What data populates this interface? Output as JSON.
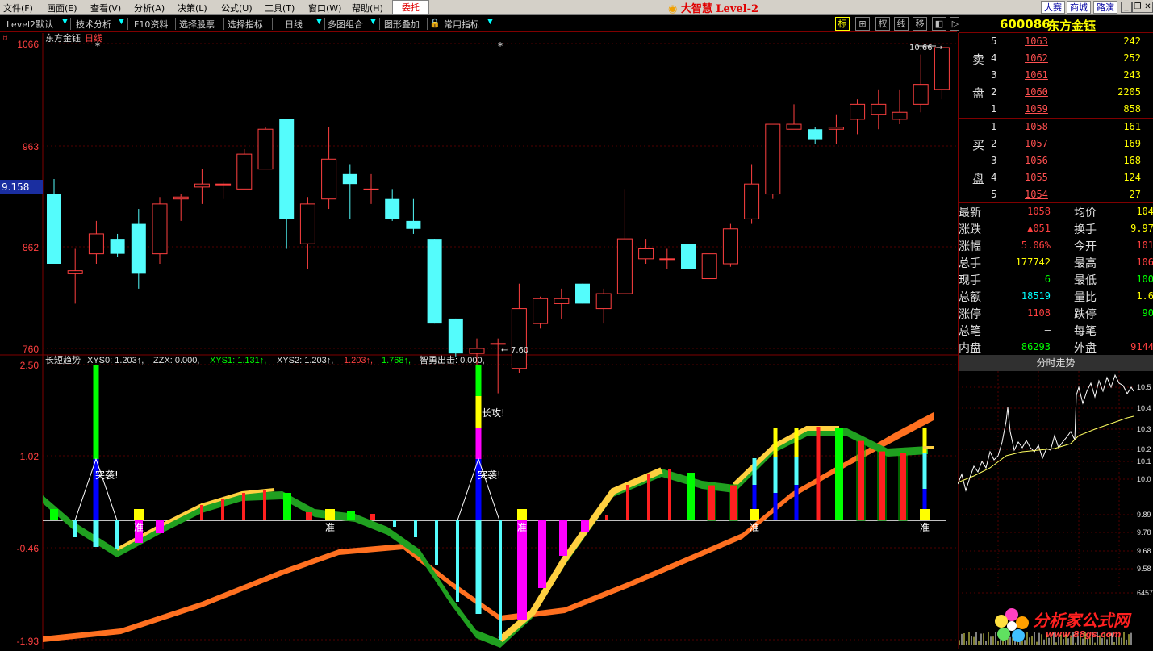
{
  "menubar": {
    "items": [
      "文件(F)",
      "画面(E)",
      "查看(V)",
      "分析(A)",
      "决策(L)",
      "公式(U)",
      "工具(T)",
      "窗口(W)",
      "帮助(H)"
    ],
    "weituo": "委托",
    "app_title": "大智慧 Level-2",
    "links": [
      "大赛",
      "商城",
      "路演"
    ]
  },
  "toolbar": {
    "items": [
      "Level2默认",
      "技术分析",
      "F10资料",
      "选择股票",
      "选择指标",
      "日线",
      "多图组合",
      "图形叠加",
      "常用指标"
    ],
    "icons": [
      "标",
      "⊞",
      "权",
      "线",
      "移",
      "◧",
      "▷"
    ]
  },
  "stock": {
    "code": "600086",
    "name": "东方金钰"
  },
  "chart": {
    "title": "东方金钰",
    "period": "日线",
    "price_axis": [
      "1066",
      "963",
      "862",
      "760"
    ],
    "crosshair_value": "9.158",
    "high_label": "10.66",
    "low_label": "7.60",
    "indicator_legend": [
      {
        "text": "长短趋势",
        "color": "#e0e0e0"
      },
      {
        "text": "XYS0: 1.203↑,",
        "color": "#e0e0e0"
      },
      {
        "text": "ZZX: 0.000,",
        "color": "#e0e0e0"
      },
      {
        "text": "XYS1: 1.131↑,",
        "color": "#00ff00"
      },
      {
        "text": "XYS2: 1.203↑,",
        "color": "#e0e0e0"
      },
      {
        "text": "1.203↑,",
        "color": "#ff4040"
      },
      {
        "text": "1.768↑,",
        "color": "#00ff00"
      },
      {
        "text": "智勇出击: 0.000,",
        "color": "#e0e0e0"
      }
    ],
    "indicator_axis": [
      "2.50",
      "1.02",
      "-0.46",
      "-1.93"
    ],
    "annotations": {
      "tuxi": "突袭!",
      "changgong": "长攻!",
      "zhun": "准"
    }
  },
  "chart_data": {
    "type": "candlestick",
    "ylim": [
      7.6,
      10.66
    ],
    "candles": [
      [
        9.15,
        8.45,
        9.3,
        8.45
      ],
      [
        8.35,
        8.38,
        8.6,
        8.05
      ],
      [
        8.55,
        8.75,
        8.88,
        8.45
      ],
      [
        8.7,
        8.55,
        8.75,
        8.52
      ],
      [
        8.85,
        8.35,
        9.0,
        8.2
      ],
      [
        8.55,
        9.05,
        9.12,
        8.45
      ],
      [
        9.1,
        9.12,
        9.15,
        8.88
      ],
      [
        9.22,
        9.25,
        9.4,
        9.05
      ],
      [
        9.25,
        9.25,
        9.28,
        9.1
      ],
      [
        9.2,
        9.55,
        9.6,
        9.2
      ],
      [
        9.4,
        9.8,
        9.82,
        9.4
      ],
      [
        9.9,
        8.9,
        9.9,
        8.6
      ],
      [
        8.65,
        9.05,
        9.12,
        8.4
      ],
      [
        9.1,
        9.5,
        9.82,
        9.0
      ],
      [
        9.35,
        9.25,
        9.45,
        8.9
      ],
      [
        9.2,
        9.2,
        9.35,
        9.05
      ],
      [
        9.1,
        8.9,
        9.2,
        8.88
      ],
      [
        8.88,
        8.8,
        9.1,
        8.75
      ],
      [
        8.7,
        7.85,
        8.7,
        7.85
      ],
      [
        7.9,
        7.55,
        7.9,
        7.52
      ],
      [
        7.55,
        7.6,
        7.7,
        7.4
      ],
      [
        7.65,
        7.65,
        7.7,
        7.15
      ],
      [
        7.4,
        8.0,
        8.25,
        7.35
      ],
      [
        7.85,
        8.1,
        8.12,
        7.8
      ],
      [
        8.05,
        8.1,
        8.2,
        7.9
      ],
      [
        8.25,
        8.05,
        8.25,
        8.05
      ],
      [
        8.0,
        8.15,
        8.2,
        7.85
      ],
      [
        8.15,
        8.7,
        9.2,
        8.15
      ],
      [
        8.5,
        8.6,
        8.7,
        8.45
      ],
      [
        8.5,
        8.5,
        8.6,
        8.4
      ],
      [
        8.65,
        8.4,
        8.65,
        8.4
      ],
      [
        8.3,
        8.55,
        8.55,
        8.3
      ],
      [
        8.45,
        8.8,
        8.85,
        8.42
      ],
      [
        8.9,
        9.25,
        9.45,
        8.85
      ],
      [
        9.15,
        9.85,
        9.85,
        9.1
      ],
      [
        9.8,
        9.85,
        10.05,
        9.8
      ],
      [
        9.8,
        9.7,
        9.82,
        9.65
      ],
      [
        9.8,
        9.82,
        9.95,
        9.65
      ],
      [
        9.9,
        10.05,
        10.1,
        9.75
      ],
      [
        9.95,
        10.05,
        10.2,
        9.8
      ],
      [
        9.9,
        9.97,
        10.2,
        9.85
      ],
      [
        10.05,
        10.25,
        10.55,
        9.97
      ],
      [
        10.2,
        10.62,
        10.66,
        10.1
      ]
    ]
  },
  "orderbook": {
    "sell_label": [
      "卖",
      "盘"
    ],
    "buy_label": [
      "买",
      "盘"
    ],
    "sell": [
      {
        "level": "5",
        "price": "1063",
        "vol": "242"
      },
      {
        "level": "4",
        "price": "1062",
        "vol": "252"
      },
      {
        "level": "3",
        "price": "1061",
        "vol": "243"
      },
      {
        "level": "2",
        "price": "1060",
        "vol": "2205"
      },
      {
        "level": "1",
        "price": "1059",
        "vol": "858"
      }
    ],
    "buy": [
      {
        "level": "1",
        "price": "1058",
        "vol": "161"
      },
      {
        "level": "2",
        "price": "1057",
        "vol": "169"
      },
      {
        "level": "3",
        "price": "1056",
        "vol": "168"
      },
      {
        "level": "4",
        "price": "1055",
        "vol": "124"
      },
      {
        "level": "5",
        "price": "1054",
        "vol": "27"
      }
    ]
  },
  "stats": [
    {
      "l": "最新",
      "v": "1058",
      "c": "#ff4040",
      "l2": "均价",
      "v2": "104",
      "c2": "#ffff00"
    },
    {
      "l": "涨跌",
      "v": "▲051",
      "c": "#ff4040",
      "l2": "换手",
      "v2": "9.97",
      "c2": "#ffff00"
    },
    {
      "l": "涨幅",
      "v": "5.06%",
      "c": "#ff4040",
      "l2": "今开",
      "v2": "101",
      "c2": "#ff4040"
    },
    {
      "l": "总手",
      "v": "177742",
      "c": "#ffff00",
      "l2": "最高",
      "v2": "106",
      "c2": "#ff4040"
    },
    {
      "l": "现手",
      "v": "6",
      "c": "#00ff00",
      "l2": "最低",
      "v2": "100",
      "c2": "#00ff00"
    },
    {
      "l": "总额",
      "v": "18519",
      "c": "#00ffff",
      "l2": "量比",
      "v2": "1.6",
      "c2": "#ffff00"
    },
    {
      "l": "涨停",
      "v": "1108",
      "c": "#ff4040",
      "l2": "跌停",
      "v2": "90",
      "c2": "#00ff00"
    },
    {
      "l": "总笔",
      "v": "–",
      "c": "#e0e0e0",
      "l2": "每笔",
      "v2": "",
      "c2": "#ffff00"
    },
    {
      "l": "内盘",
      "v": "86293",
      "c": "#00ff00",
      "l2": "外盘",
      "v2": "9144",
      "c2": "#ff4040"
    }
  ],
  "minichart": {
    "title": "分时走势",
    "axis": [
      "10.5",
      "10.4",
      "10.3",
      "10.2",
      "10.1",
      "10.0",
      "9.89",
      "9.78",
      "9.68",
      "9.58",
      "6457"
    ]
  },
  "logo": {
    "text": "分析家公式网",
    "url": "www.88gs.com"
  }
}
